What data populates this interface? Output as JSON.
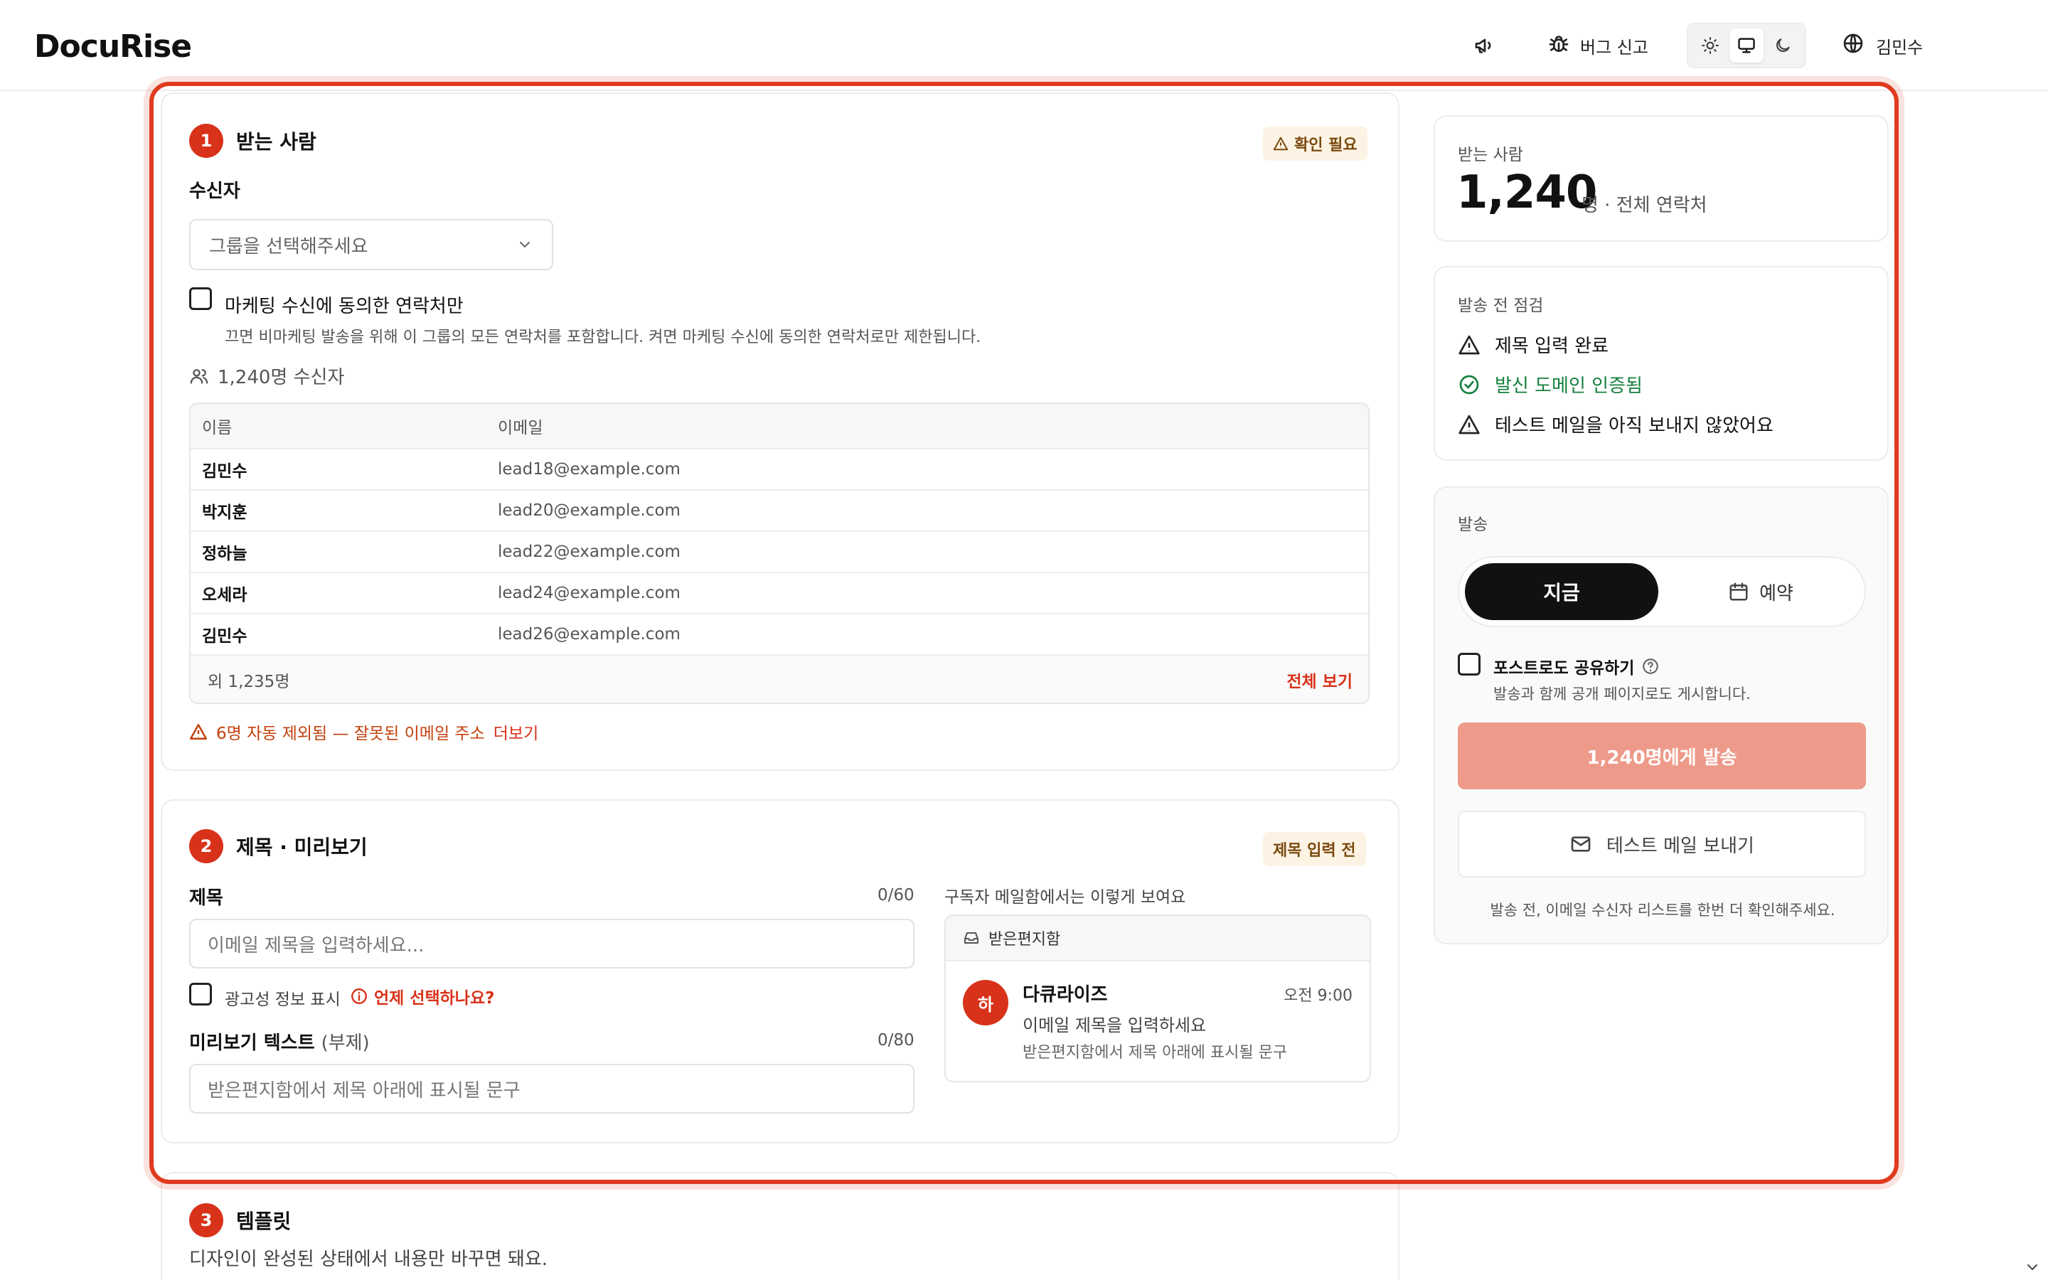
{
  "app": {
    "logo": "DocuRise",
    "bug_report": "버그 신고",
    "user_name": "김민수"
  },
  "recipients": {
    "step": "1",
    "title": "받는 사람",
    "status_tag": "확인 필요",
    "field_label": "수신자",
    "group_select": {
      "placeholder": "그룹을 선택해주세요"
    },
    "marketing_checkbox": {
      "label": "마케팅 수신에 동의한 연락처만",
      "help": "끄면 비마케팅 발송을 위해 이 그룹의 모든 연락처를 포함합니다. 켜면 마케팅 수신에 동의한 연락처로만 제한됩니다."
    },
    "count_text": "1,240명 수신자",
    "table": {
      "columns": [
        "이름",
        "이메일"
      ],
      "rows": [
        {
          "name": "김민수",
          "email": "lead18@example.com"
        },
        {
          "name": "박지훈",
          "email": "lead20@example.com"
        },
        {
          "name": "정하늘",
          "email": "lead22@example.com"
        },
        {
          "name": "오세라",
          "email": "lead24@example.com"
        },
        {
          "name": "김민수",
          "email": "lead26@example.com"
        }
      ],
      "more_count": "외 1,235명",
      "view_all": "전체 보기"
    },
    "excluded_warning": "6명 자동 제외됨 — 잘못된 이메일 주소",
    "excluded_more": "더보기"
  },
  "subject": {
    "step": "2",
    "title": "제목 · 미리보기",
    "status_tag": "제목 입력 전",
    "subject_label": "제목",
    "subject_count": "0/60",
    "subject_placeholder": "이메일 제목을 입력하세요...",
    "ad_checkbox_label": "광고성 정보 표시",
    "ad_help_link": "언제 선택하나요?",
    "preview_label": "미리보기 텍스트",
    "preview_sub": "(부제)",
    "preview_count": "0/80",
    "preview_placeholder": "받은편지함에서 제목 아래에 표시될 문구",
    "inbox_caption": "구독자 메일함에서는 이렇게 보여요",
    "inbox": {
      "header": "받은편지함",
      "avatar_letter": "하",
      "sender": "다큐라이즈",
      "time": "오전 9:00",
      "subject": "이메일 제목을 입력하세요",
      "preview": "받은편지함에서 제목 아래에 표시될 문구"
    }
  },
  "template": {
    "step": "3",
    "title": "템플릿",
    "desc": "디자인이 완성된 상태에서 내용만 바꾸면 돼요."
  },
  "summary": {
    "label": "받는 사람",
    "count": "1,240",
    "unit": "명 · 전체 연락처"
  },
  "checklist": {
    "title": "발송 전 점검",
    "items": [
      {
        "text": "제목 입력 완료",
        "status": "warning"
      },
      {
        "text": "발신 도메인 인증됨",
        "status": "ok"
      },
      {
        "text": "테스트 메일을 아직 보내지 않았어요",
        "status": "warning"
      }
    ]
  },
  "send": {
    "title": "발송",
    "now": "지금",
    "schedule": "예약",
    "post_checkbox_label": "포스트로도 공유하기",
    "post_help": "발송과 함께 공개 페이지로도 게시합니다.",
    "send_button": "1,240명에게 발송",
    "test_button": "테스트 메일 보내기",
    "footnote": "발송 전, 이메일 수신자 리스트를 한번 더 확인해주세요."
  },
  "colors": {
    "accent": "#d8321a",
    "send_disabled": "#ee9a8a",
    "success": "#15803d",
    "warning_tag_bg": "#fdf3e4"
  }
}
